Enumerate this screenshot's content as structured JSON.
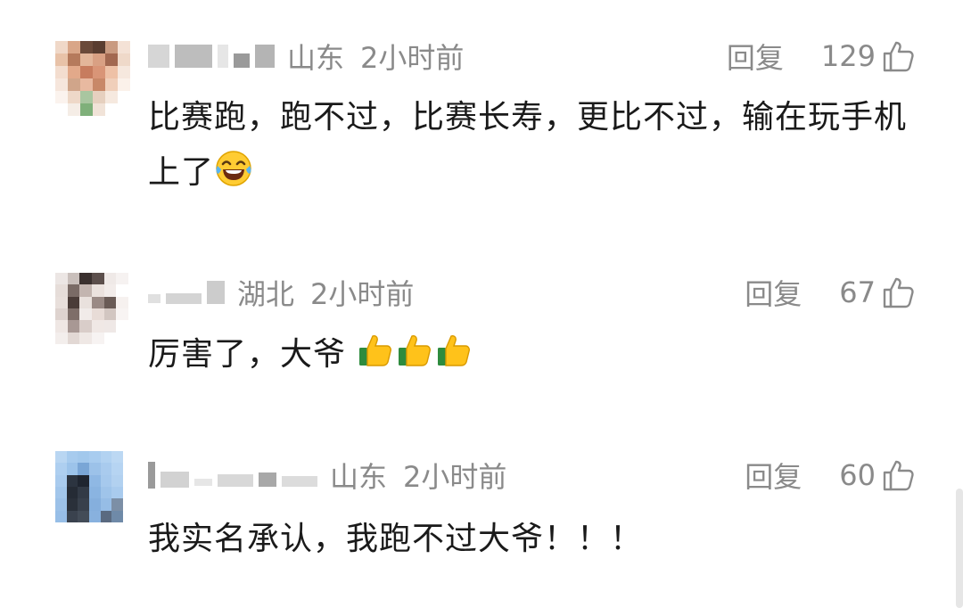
{
  "comments": [
    {
      "location": "山东",
      "time": "2小时前",
      "reply_label": "回复",
      "likes": "129",
      "text": "比赛跑，跑不过，比赛长寿，更比不过，输在玩手机上了",
      "emoji": "laughing-tears-emoji"
    },
    {
      "location": "湖北",
      "time": "2小时前",
      "reply_label": "回复",
      "likes": "67",
      "text": "厉害了，大爷",
      "emoji": "thumbs-up-emoji x3"
    },
    {
      "location": "山东",
      "time": "2小时前",
      "reply_label": "回复",
      "likes": "60",
      "text": "我实名承认，我跑不过大爷！！！"
    }
  ],
  "colors": {
    "text": "#1a1a1a",
    "meta": "#8a8a8a",
    "background": "#ffffff"
  }
}
